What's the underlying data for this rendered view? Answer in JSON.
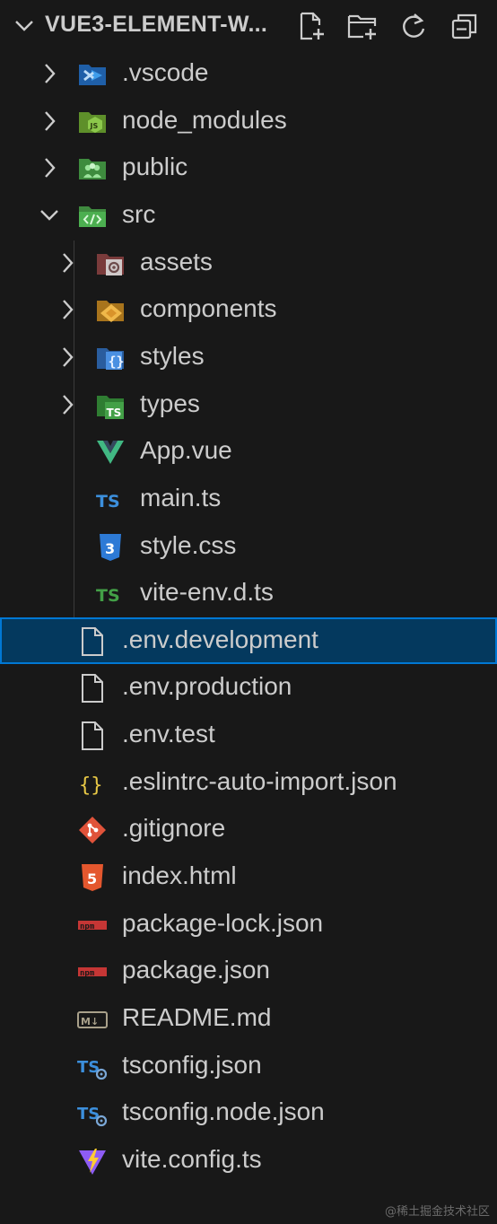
{
  "explorer": {
    "title": "VUE3-ELEMENT-W...",
    "actions": [
      {
        "name": "new-file-icon"
      },
      {
        "name": "new-folder-icon"
      },
      {
        "name": "refresh-icon"
      },
      {
        "name": "collapse-all-icon"
      }
    ]
  },
  "tree": [
    {
      "label": ".vscode",
      "icon": "vscode-folder-icon",
      "kind": "folder",
      "expanded": false,
      "depth": 0
    },
    {
      "label": "node_modules",
      "icon": "node-folder-icon",
      "kind": "folder",
      "expanded": false,
      "depth": 0
    },
    {
      "label": "public",
      "icon": "public-folder-icon",
      "kind": "folder",
      "expanded": false,
      "depth": 0
    },
    {
      "label": "src",
      "icon": "src-folder-icon",
      "kind": "folder",
      "expanded": true,
      "depth": 0
    },
    {
      "label": "assets",
      "icon": "assets-folder-icon",
      "kind": "folder",
      "expanded": false,
      "depth": 1
    },
    {
      "label": "components",
      "icon": "components-folder-icon",
      "kind": "folder",
      "expanded": false,
      "depth": 1
    },
    {
      "label": "styles",
      "icon": "styles-folder-icon",
      "kind": "folder",
      "expanded": false,
      "depth": 1
    },
    {
      "label": "types",
      "icon": "types-folder-icon",
      "kind": "folder",
      "expanded": false,
      "depth": 1
    },
    {
      "label": "App.vue",
      "icon": "vue-file-icon",
      "kind": "file",
      "depth": 1
    },
    {
      "label": "main.ts",
      "icon": "typescript-file-icon",
      "kind": "file",
      "depth": 1
    },
    {
      "label": "style.css",
      "icon": "css-file-icon",
      "kind": "file",
      "depth": 1
    },
    {
      "label": "vite-env.d.ts",
      "icon": "typescript-def-file-icon",
      "kind": "file",
      "depth": 1
    },
    {
      "label": ".env.development",
      "icon": "blank-file-icon",
      "kind": "file",
      "depth": 0,
      "selected": true
    },
    {
      "label": ".env.production",
      "icon": "blank-file-icon",
      "kind": "file",
      "depth": 0
    },
    {
      "label": ".env.test",
      "icon": "blank-file-icon",
      "kind": "file",
      "depth": 0
    },
    {
      "label": ".eslintrc-auto-import.json",
      "icon": "json-file-icon",
      "kind": "file",
      "depth": 0
    },
    {
      "label": ".gitignore",
      "icon": "git-file-icon",
      "kind": "file",
      "depth": 0
    },
    {
      "label": "index.html",
      "icon": "html-file-icon",
      "kind": "file",
      "depth": 0
    },
    {
      "label": "package-lock.json",
      "icon": "npm-file-icon",
      "kind": "file",
      "depth": 0
    },
    {
      "label": "package.json",
      "icon": "npm-file-icon",
      "kind": "file",
      "depth": 0
    },
    {
      "label": "README.md",
      "icon": "markdown-file-icon",
      "kind": "file",
      "depth": 0
    },
    {
      "label": "tsconfig.json",
      "icon": "tsconfig-file-icon",
      "kind": "file",
      "depth": 0
    },
    {
      "label": "tsconfig.node.json",
      "icon": "tsconfig-file-icon",
      "kind": "file",
      "depth": 0
    },
    {
      "label": "vite.config.ts",
      "icon": "vite-file-icon",
      "kind": "file",
      "depth": 0
    }
  ],
  "watermark": "@稀土掘金技术社区",
  "colors": {
    "background": "#181818",
    "text": "#cccccc",
    "selection_bg": "#04395e",
    "selection_border": "#0078d4"
  }
}
